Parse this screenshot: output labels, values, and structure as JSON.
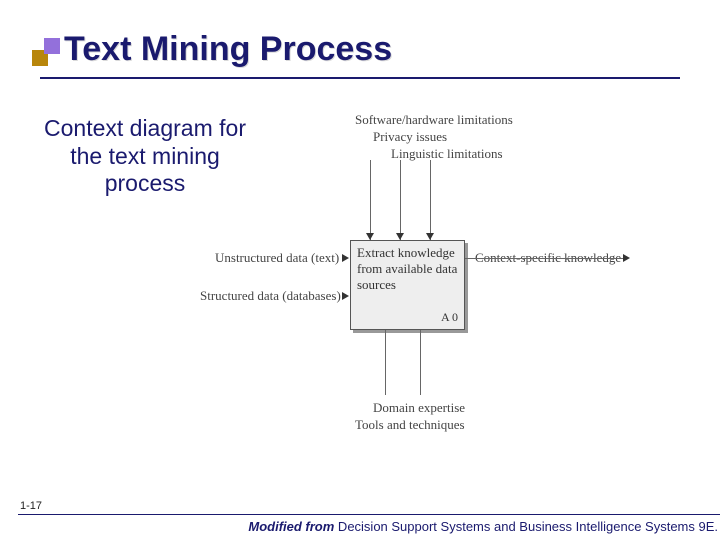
{
  "title": "Text Mining Process",
  "subtitle": "Context diagram for the text mining process",
  "diagram": {
    "constraints": [
      "Software/hardware limitations",
      "Privacy issues",
      "Linguistic limitations"
    ],
    "inputs": [
      "Unstructured data (text)",
      "Structured data (databases)"
    ],
    "process": {
      "label": "Extract knowledge from available data sources",
      "node": "A 0"
    },
    "output": "Context-specific knowledge",
    "mechanisms": [
      "Domain expertise",
      "Tools and techniques"
    ]
  },
  "page_number": "1-17",
  "footer": {
    "prefix": "Modified from",
    "source": " Decision Support Systems and Business Intelligence Systems 9E."
  }
}
